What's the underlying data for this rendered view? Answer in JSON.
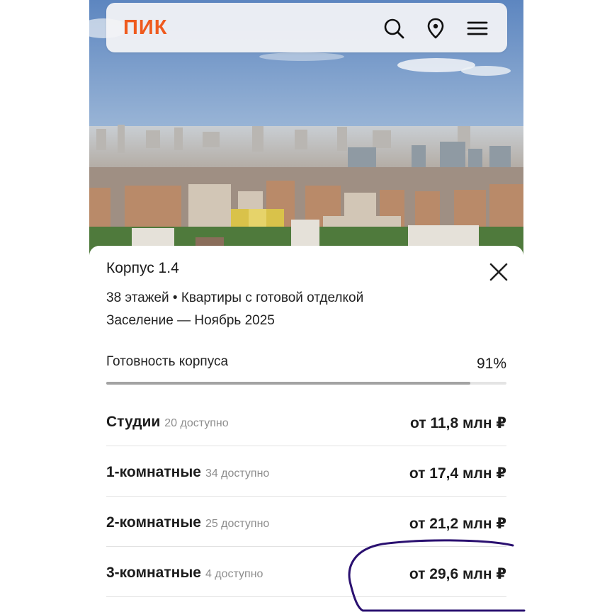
{
  "header": {
    "logo_text": "ПИК",
    "brand_color": "#ef5a1e",
    "icons": [
      "search-icon",
      "location-pin-icon",
      "menu-icon"
    ]
  },
  "building": {
    "title": "Корпус 1.4",
    "details": "38 этажей • Квартиры с готовой отделкой",
    "move_in": "Заселение — Ноябрь 2025",
    "readiness_label": "Готовность корпуса",
    "readiness_value": "91%",
    "readiness_fraction": 0.91
  },
  "apartments": [
    {
      "name": "Студии",
      "available": "20 доступно",
      "price": "от 11,8 млн ₽"
    },
    {
      "name": "1-комнатные",
      "available": "34 доступно",
      "price": "от 17,4 млн ₽"
    },
    {
      "name": "2-комнатные",
      "available": "25 доступно",
      "price": "от 21,2 млн ₽"
    },
    {
      "name": "3-комнатные",
      "available": "4 доступно",
      "price": "от 29,6 млн ₽"
    }
  ],
  "annotation": {
    "color": "#2a1070",
    "target": "3-комнатные price"
  }
}
